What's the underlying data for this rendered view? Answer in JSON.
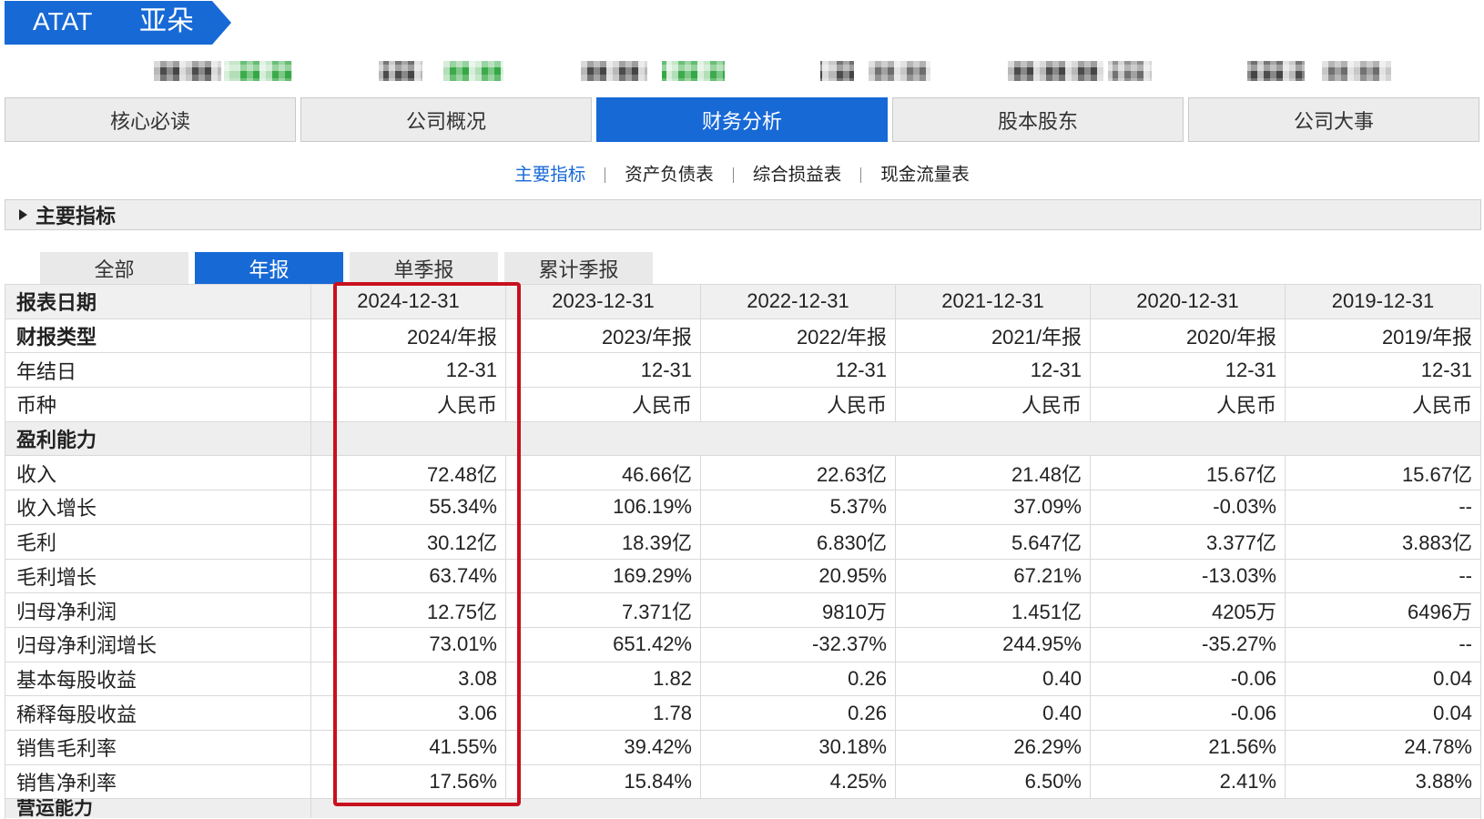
{
  "theme": {
    "accent": "#1769d6",
    "highlight": "#c8101e",
    "tab_bg": "#ececec",
    "header_bg": "#f0f0f0",
    "section_bg": "#eeeeee",
    "border": "#d9d9d9"
  },
  "stock": {
    "ticker": "ATAT",
    "name": "亚朵"
  },
  "main_tabs": [
    {
      "label": "核心必读",
      "active": false
    },
    {
      "label": "公司概况",
      "active": false
    },
    {
      "label": "财务分析",
      "active": true
    },
    {
      "label": "股本股东",
      "active": false
    },
    {
      "label": "公司大事",
      "active": false
    }
  ],
  "sub_nav": [
    {
      "label": "主要指标",
      "active": true
    },
    {
      "label": "资产负债表",
      "active": false
    },
    {
      "label": "综合损益表",
      "active": false
    },
    {
      "label": "现金流量表",
      "active": false
    }
  ],
  "section": {
    "title": "主要指标",
    "icon": "caret-right-icon"
  },
  "report_tabs": [
    {
      "label": "全部",
      "active": false
    },
    {
      "label": "年报",
      "active": true
    },
    {
      "label": "单季报",
      "active": false
    },
    {
      "label": "累计季报",
      "active": false
    }
  ],
  "table": {
    "header_label": "报表日期",
    "columns": [
      {
        "date": "2024-12-31",
        "highlighted": true
      },
      {
        "date": "2023-12-31",
        "highlighted": false
      },
      {
        "date": "2022-12-31",
        "highlighted": false
      },
      {
        "date": "2021-12-31",
        "highlighted": false
      },
      {
        "date": "2020-12-31",
        "highlighted": false
      },
      {
        "date": "2019-12-31",
        "highlighted": false
      }
    ],
    "rows": [
      {
        "label": "财报类型",
        "bold": true,
        "values": [
          "2024/年报",
          "2023/年报",
          "2022/年报",
          "2021/年报",
          "2020/年报",
          "2019/年报"
        ]
      },
      {
        "label": "年结日",
        "values": [
          "12-31",
          "12-31",
          "12-31",
          "12-31",
          "12-31",
          "12-31"
        ]
      },
      {
        "label": "币种",
        "values": [
          "人民币",
          "人民币",
          "人民币",
          "人民币",
          "人民币",
          "人民币"
        ]
      },
      {
        "label": "盈利能力",
        "section": true
      },
      {
        "label": "收入",
        "values": [
          "72.48亿",
          "46.66亿",
          "22.63亿",
          "21.48亿",
          "15.67亿",
          "15.67亿"
        ]
      },
      {
        "label": "收入增长",
        "values": [
          "55.34%",
          "106.19%",
          "5.37%",
          "37.09%",
          "-0.03%",
          "--"
        ]
      },
      {
        "label": "毛利",
        "values": [
          "30.12亿",
          "18.39亿",
          "6.830亿",
          "5.647亿",
          "3.377亿",
          "3.883亿"
        ]
      },
      {
        "label": "毛利增长",
        "values": [
          "63.74%",
          "169.29%",
          "20.95%",
          "67.21%",
          "-13.03%",
          "--"
        ]
      },
      {
        "label": "归母净利润",
        "values": [
          "12.75亿",
          "7.371亿",
          "9810万",
          "1.451亿",
          "4205万",
          "6496万"
        ]
      },
      {
        "label": "归母净利润增长",
        "values": [
          "73.01%",
          "651.42%",
          "-32.37%",
          "244.95%",
          "-35.27%",
          "--"
        ]
      },
      {
        "label": "基本每股收益",
        "values": [
          "3.08",
          "1.82",
          "0.26",
          "0.40",
          "-0.06",
          "0.04"
        ]
      },
      {
        "label": "稀释每股收益",
        "values": [
          "3.06",
          "1.78",
          "0.26",
          "0.40",
          "-0.06",
          "0.04"
        ]
      },
      {
        "label": "销售毛利率",
        "values": [
          "41.55%",
          "39.42%",
          "30.18%",
          "26.29%",
          "21.56%",
          "24.78%"
        ]
      },
      {
        "label": "销售净利率",
        "values": [
          "17.56%",
          "15.84%",
          "4.25%",
          "6.50%",
          "2.41%",
          "3.88%"
        ]
      },
      {
        "label": "营运能力",
        "section": true
      }
    ]
  }
}
